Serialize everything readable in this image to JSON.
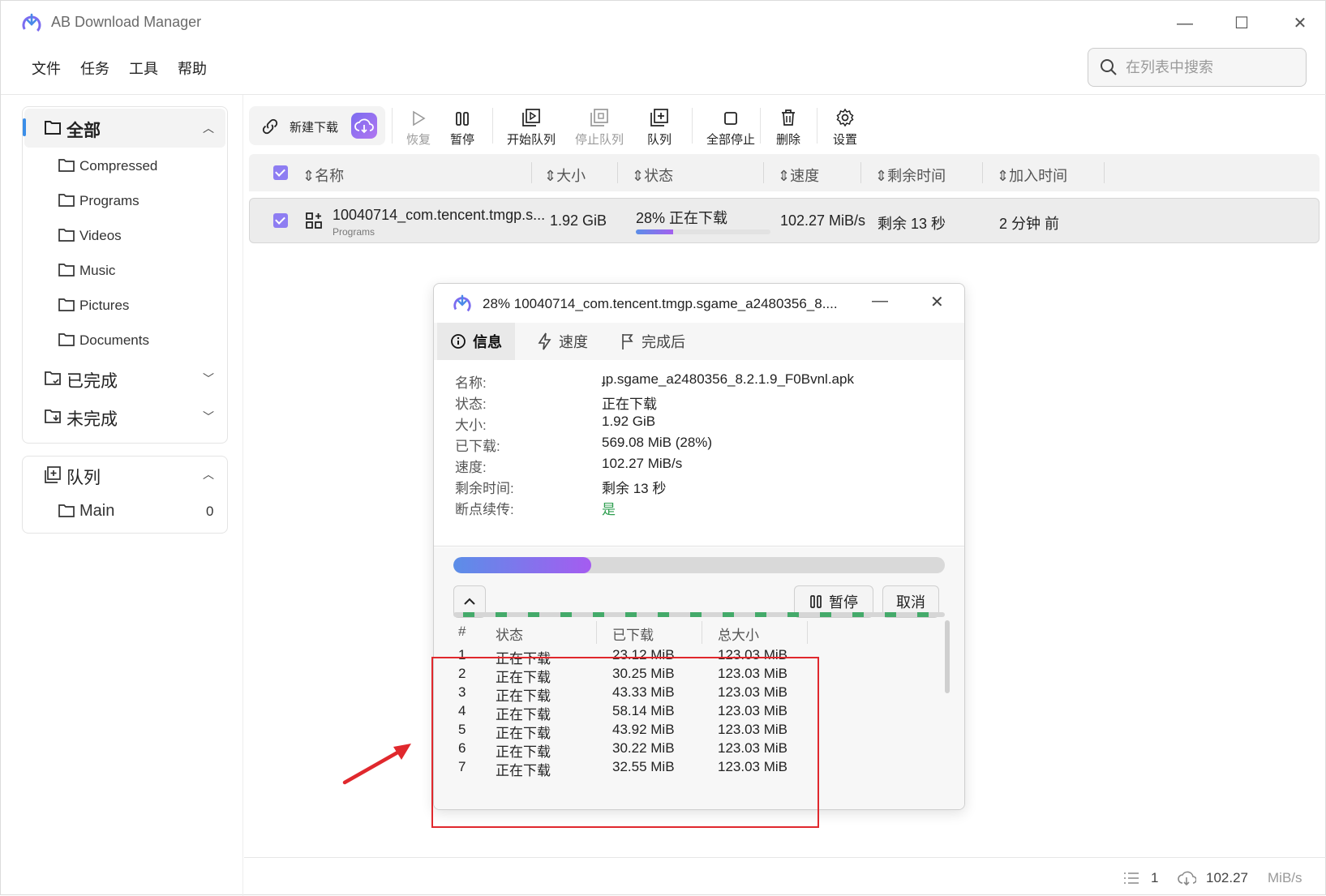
{
  "app": {
    "title": "AB Download Manager"
  },
  "menu": [
    "文件",
    "任务",
    "工具",
    "帮助"
  ],
  "search": {
    "placeholder": "在列表中搜索"
  },
  "sidebar": {
    "all_label": "全部",
    "categories": [
      "Compressed",
      "Programs",
      "Videos",
      "Music",
      "Pictures",
      "Documents"
    ],
    "finished_label": "已完成",
    "unfinished_label": "未完成",
    "queue_label": "队列",
    "queues": [
      {
        "name": "Main",
        "count": "0"
      }
    ]
  },
  "toolbar": {
    "new_download": "新建下载",
    "resume": "恢复",
    "pause": "暂停",
    "start_queue": "开始队列",
    "stop_queue": "停止队列",
    "queue": "队列",
    "stop_all": "全部停止",
    "delete": "删除",
    "settings": "设置"
  },
  "table": {
    "headers": [
      "名称",
      "大小",
      "状态",
      "速度",
      "剩余时间",
      "加入时间"
    ],
    "rows": [
      {
        "name": "10040714_com.tencent.tmgp.s...",
        "category": "Programs",
        "size": "1.92 GiB",
        "status": "28% 正在下载",
        "progress_percent": 28,
        "speed": "102.27 MiB/s",
        "remaining": "剩余 13 秒",
        "added": "2 分钟 前"
      }
    ]
  },
  "dialog": {
    "title": "28% 10040714_com.tencent.tmgp.sgame_a2480356_8....",
    "tabs": [
      "信息",
      "速度",
      "完成后"
    ],
    "info": [
      {
        "key": "名称:",
        "value": "ɟp.sgame_a2480356_8.2.1.9_F0Bvnl.apk"
      },
      {
        "key": "状态:",
        "value": "正在下载"
      },
      {
        "key": "大小:",
        "value": "1.92 GiB"
      },
      {
        "key": "已下载:",
        "value": "569.08 MiB (28%)"
      },
      {
        "key": "速度:",
        "value": "102.27 MiB/s"
      },
      {
        "key": "剩余时间:",
        "value": "剩余 13 秒"
      },
      {
        "key": "断点续传:",
        "value": "是"
      }
    ],
    "progress_percent": 28,
    "pause_label": "暂停",
    "cancel_label": "取消",
    "parts_headers": [
      "#",
      "状态",
      "已下载",
      "总大小"
    ],
    "parts": [
      {
        "n": "1",
        "status": "正在下载",
        "downloaded": "23.12 MiB",
        "total": "123.03 MiB"
      },
      {
        "n": "2",
        "status": "正在下载",
        "downloaded": "30.25 MiB",
        "total": "123.03 MiB"
      },
      {
        "n": "3",
        "status": "正在下载",
        "downloaded": "43.33 MiB",
        "total": "123.03 MiB"
      },
      {
        "n": "4",
        "status": "正在下载",
        "downloaded": "58.14 MiB",
        "total": "123.03 MiB"
      },
      {
        "n": "5",
        "status": "正在下载",
        "downloaded": "43.92 MiB",
        "total": "123.03 MiB"
      },
      {
        "n": "6",
        "status": "正在下载",
        "downloaded": "30.22 MiB",
        "total": "123.03 MiB"
      },
      {
        "n": "7",
        "status": "正在下载",
        "downloaded": "32.55 MiB",
        "total": "123.03 MiB"
      }
    ]
  },
  "statusbar": {
    "active_count": "1",
    "speed_value": "102.27",
    "speed_unit": "MiB/s"
  },
  "colors": {
    "accent": "#8e7df2",
    "success": "#2e9e4f",
    "annotation": "#e0282d"
  }
}
